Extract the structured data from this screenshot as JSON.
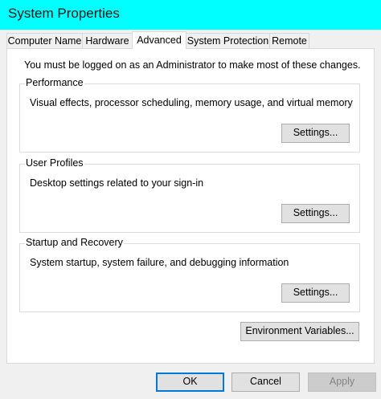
{
  "window": {
    "title": "System Properties"
  },
  "tabs": [
    {
      "label": "Computer Name"
    },
    {
      "label": "Hardware"
    },
    {
      "label": "Advanced",
      "active": true
    },
    {
      "label": "System Protection"
    },
    {
      "label": "Remote"
    }
  ],
  "advanced": {
    "notice": "You must be logged on as an Administrator to make most of these changes.",
    "performance": {
      "label": "Performance",
      "description": "Visual effects, processor scheduling, memory usage, and virtual memory",
      "button": "Settings..."
    },
    "user_profiles": {
      "label": "User Profiles",
      "description": "Desktop settings related to your sign-in",
      "button": "Settings..."
    },
    "startup_recovery": {
      "label": "Startup and Recovery",
      "description": "System startup, system failure, and debugging information",
      "button": "Settings..."
    },
    "environment_button": "Environment Variables..."
  },
  "footer": {
    "ok": "OK",
    "cancel": "Cancel",
    "apply": "Apply",
    "apply_enabled": false
  },
  "colors": {
    "titlebar": "#00ffff",
    "dialog_bg": "#f0f0f0",
    "panel_bg": "#ffffff",
    "default_button_border": "#0078d7"
  }
}
